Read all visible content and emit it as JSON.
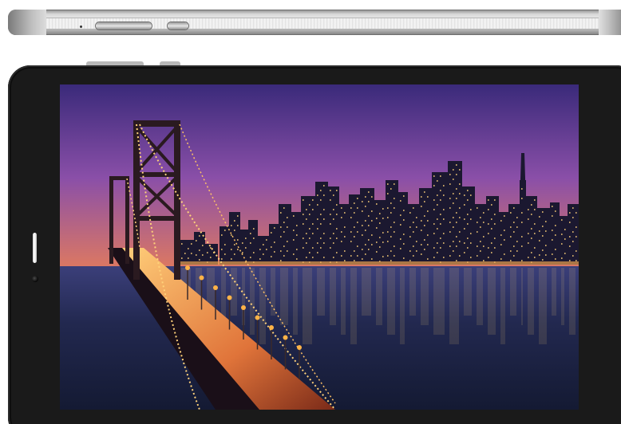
{
  "device": {
    "type": "tablet",
    "bezel_color": "#1a1a1a",
    "frame_color": "#c8c8c8"
  },
  "wallpaper": {
    "subject": "city-skyline-at-dusk-with-lit-suspension-bridge",
    "colors": {
      "sky_top": "#3a2a7a",
      "sky_mid": "#8a4fa8",
      "sky_horizon": "#e07a5f",
      "water": "#1c2547",
      "bridge_lights": "#ffb347",
      "city_lights": "#ffd27a"
    }
  }
}
